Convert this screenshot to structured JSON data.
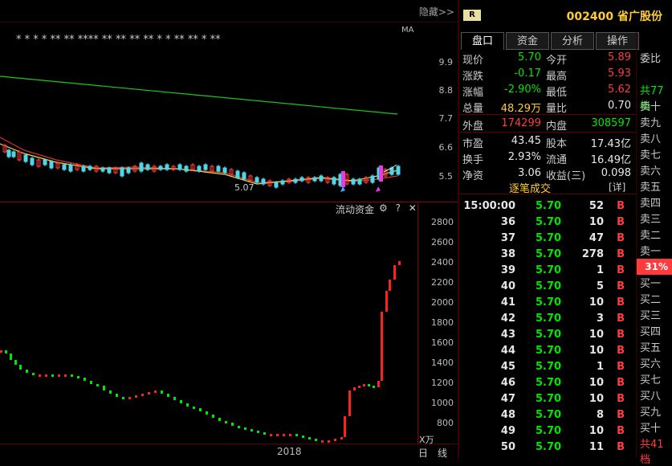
{
  "topbar": {
    "hide_label": "隐藏>>"
  },
  "header": {
    "badge": "R",
    "stock_title": "002400 省广股份"
  },
  "kline": {
    "ma_label": "MA",
    "price_ticks": [
      "9.9",
      "8.8",
      "7.7",
      "6.6",
      "5.5"
    ],
    "low_label": "5.07",
    "stars": "* * * * ** ** **** ** ** ** ** * * ** ** * **"
  },
  "fund_flow": {
    "title": "流动资金",
    "gear_icon": "⚙",
    "help_icon": "?",
    "close_icon": "✕",
    "ticks": [
      "2800",
      "2600",
      "2400",
      "2200",
      "2000",
      "1800",
      "1600",
      "1400",
      "1200",
      "1000",
      "800"
    ],
    "unit": "X万"
  },
  "bottom": {
    "year": "2018",
    "day_btn": "日",
    "line_btn": "线"
  },
  "tabs": [
    "盘口",
    "资金",
    "分析",
    "操作"
  ],
  "quote": [
    {
      "l1": "现价",
      "v1": "5.70",
      "c1": "green",
      "l2": "今开",
      "v2": "5.89",
      "c2": "red"
    },
    {
      "l1": "涨跌",
      "v1": "-0.17",
      "c1": "green",
      "l2": "最高",
      "v2": "5.93",
      "c2": "red"
    },
    {
      "l1": "涨幅",
      "v1": "-2.90%",
      "c1": "green",
      "l2": "最低",
      "v2": "5.62",
      "c2": "red"
    },
    {
      "l1": "总量",
      "v1": "48.29万",
      "c1": "yellow",
      "l2": "量比",
      "v2": "0.70",
      "c2": "white"
    },
    {
      "l1": "外盘",
      "v1": "174299",
      "c1": "red",
      "l2": "内盘",
      "v2": "308597",
      "c2": "green"
    },
    {
      "l1": "市盈",
      "v1": "43.45",
      "c1": "white",
      "l2": "股本",
      "v2": "17.43亿",
      "c2": "white"
    },
    {
      "l1": "换手",
      "v1": "2.93%",
      "c1": "white",
      "l2": "流通",
      "v2": "16.49亿",
      "c2": "white"
    },
    {
      "l1": "净资",
      "v1": "3.06",
      "c1": "white",
      "l2": "收益(三)",
      "v2": "0.098",
      "c2": "white"
    }
  ],
  "trades_header": {
    "title": "逐笔成交",
    "detail": "[详]"
  },
  "trades": [
    {
      "time": "15:00:00",
      "price": "5.70",
      "vol": "52",
      "side": "B"
    },
    {
      "time": "36",
      "price": "5.70",
      "vol": "10",
      "side": "B"
    },
    {
      "time": "37",
      "price": "5.70",
      "vol": "47",
      "side": "B"
    },
    {
      "time": "38",
      "price": "5.70",
      "vol": "278",
      "side": "B"
    },
    {
      "time": "39",
      "price": "5.70",
      "vol": "1",
      "side": "B"
    },
    {
      "time": "40",
      "price": "5.70",
      "vol": "5",
      "side": "B"
    },
    {
      "time": "41",
      "price": "5.70",
      "vol": "10",
      "side": "B"
    },
    {
      "time": "42",
      "price": "5.70",
      "vol": "3",
      "side": "B"
    },
    {
      "time": "43",
      "price": "5.70",
      "vol": "10",
      "side": "B"
    },
    {
      "time": "44",
      "price": "5.70",
      "vol": "10",
      "side": "B"
    },
    {
      "time": "45",
      "price": "5.70",
      "vol": "1",
      "side": "B"
    },
    {
      "time": "46",
      "price": "5.70",
      "vol": "10",
      "side": "B"
    },
    {
      "time": "47",
      "price": "5.70",
      "vol": "10",
      "side": "B"
    },
    {
      "time": "48",
      "price": "5.70",
      "vol": "8",
      "side": "B"
    },
    {
      "time": "49",
      "price": "5.70",
      "vol": "10",
      "side": "B"
    },
    {
      "time": "50",
      "price": "5.70",
      "vol": "11",
      "side": "B"
    }
  ],
  "orderbook": {
    "entrust_ratio": "委比",
    "total_sell": "共77档",
    "sell_levels": [
      "卖十",
      "卖九",
      "卖八",
      "卖七",
      "卖六",
      "卖五",
      "卖四",
      "卖三",
      "卖二",
      "卖一"
    ],
    "ratio_value": "31%",
    "buy_levels": [
      "买一",
      "买二",
      "买三",
      "买四",
      "买五",
      "买六",
      "买七",
      "买八",
      "买九",
      "买十"
    ],
    "total_buy": "共41档"
  },
  "colors": {
    "up": "#ff3b3b",
    "down": "#00e600",
    "accent": "#ffcc33",
    "frame": "#8b0000"
  }
}
